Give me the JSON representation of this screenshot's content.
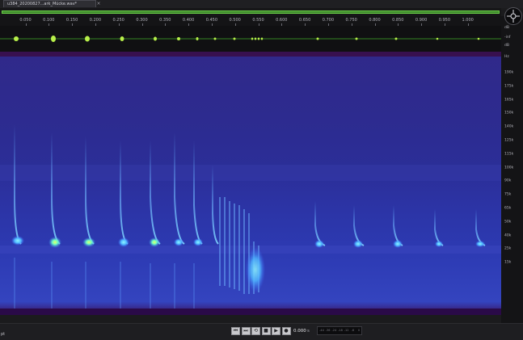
{
  "tab": {
    "title": "u384_20200827...ark_Mücke.wav*",
    "close": "×"
  },
  "ruler": {
    "ticks": [
      "0.050",
      "0.100",
      "0.150",
      "0.200",
      "0.250",
      "0.300",
      "0.350",
      "0.400",
      "0.450",
      "0.500",
      "0.550",
      "0.600",
      "0.650",
      "0.700",
      "0.750",
      "0.800",
      "0.850",
      "0.900",
      "0.950",
      "1.000"
    ]
  },
  "waveform_axis": {
    "top": "dB",
    "mid": "-inf",
    "bottom": "dB"
  },
  "frequency_axis": {
    "unit": "Hz",
    "labels": [
      "190k",
      "175k",
      "165k",
      "150k",
      "140k",
      "125k",
      "115k",
      "100k",
      "90k",
      "75k",
      "65k",
      "50k",
      "40k",
      "25k",
      "15k"
    ]
  },
  "transport": {
    "buttons": [
      {
        "name": "go-to-start-button",
        "glyph": "⏮"
      },
      {
        "name": "go-to-end-button",
        "glyph": "⏭"
      },
      {
        "name": "loop-button",
        "glyph": "⟲"
      },
      {
        "name": "stop-button",
        "glyph": "■"
      },
      {
        "name": "play-button",
        "glyph": "▶"
      },
      {
        "name": "record-button",
        "glyph": "●"
      }
    ],
    "time": "0.000",
    "time_unit": "s",
    "meter_ticks": [
      "-44",
      "-36",
      "-24",
      "-18",
      "-12",
      "-6",
      "0"
    ]
  },
  "status_text": "pt"
}
